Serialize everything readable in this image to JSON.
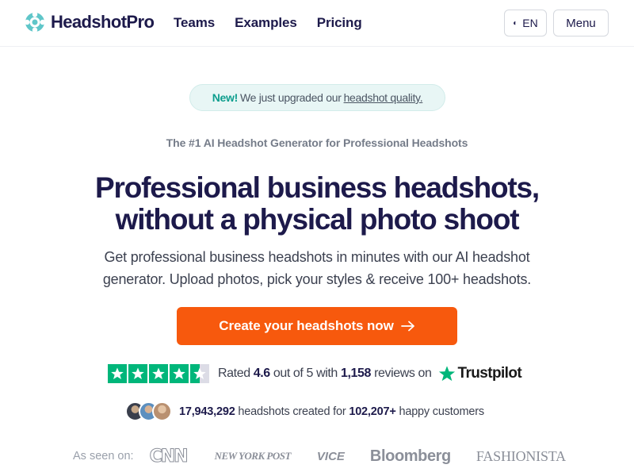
{
  "header": {
    "brand": "HeadshotPro",
    "nav": [
      "Teams",
      "Examples",
      "Pricing"
    ],
    "language": "EN",
    "menu_label": "Menu"
  },
  "announcement": {
    "badge": "New!",
    "text": "We just upgraded our",
    "link": "headshot quality."
  },
  "hero": {
    "tagline": "The #1 AI Headshot Generator for Professional Headshots",
    "headline_line1": "Professional business headshots,",
    "headline_line2": "without a physical photo shoot",
    "subhead_line1": "Get professional business headshots in minutes with our AI headshot",
    "subhead_line2": "generator. Upload photos, pick your styles & receive 100+ headshots.",
    "cta_label": "Create your headshots now"
  },
  "rating": {
    "stars": 4.6,
    "prefix": "Rated",
    "score": "4.6",
    "mid": "out of 5 with",
    "count": "1,158",
    "suffix": "reviews on",
    "provider": "Trustpilot"
  },
  "social_proof": {
    "headshots": "17,943,292",
    "mid": "headshots created for",
    "customers": "102,207+",
    "suffix": "happy customers"
  },
  "press": {
    "label": "As seen on:",
    "logos": [
      "CNN",
      "NEW YORK POST",
      "VICE",
      "Bloomberg",
      "FASHIONISTA"
    ]
  },
  "colors": {
    "accent": "#f7590d",
    "brand_dark": "#1d1a4b",
    "teal": "#0e9e8e",
    "trustpilot_green": "#00b67a"
  }
}
